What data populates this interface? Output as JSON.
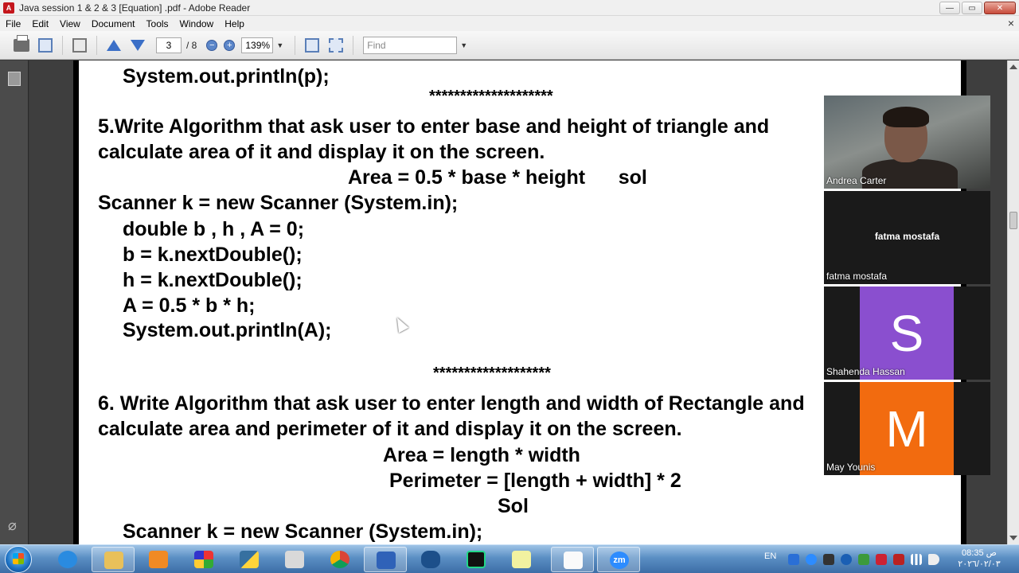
{
  "window": {
    "title": "Java session 1 & 2 & 3 [Equation] .pdf - Adobe Reader",
    "app_icon": "pdf-icon",
    "controls": {
      "minimize": "—",
      "restore": "▭",
      "close": "✕"
    }
  },
  "menu": {
    "items": [
      "File",
      "Edit",
      "View",
      "Document",
      "Tools",
      "Window",
      "Help"
    ],
    "close_glyph": "×"
  },
  "toolbar": {
    "page_current": "3",
    "page_total": "/ 8",
    "zoom_out": "−",
    "zoom_in": "+",
    "zoom_value": "139%",
    "find_placeholder": "Find",
    "icons": [
      "printer-icon",
      "pages-dropdown-icon",
      "collaborate-icon",
      "previous-page-icon",
      "next-page-icon",
      "zoom-out-icon",
      "zoom-in-icon",
      "fit-page-icon",
      "fit-width-icon"
    ]
  },
  "leftnav": {
    "icons": [
      "pages-panel-icon",
      "attachments-icon"
    ],
    "clip_glyph": "⌀"
  },
  "document": {
    "lines": [
      "System.out.println(p);",
      "********************",
      "5.Write Algorithm that ask user to enter base and height of triangle and",
      "calculate area of it and display it on the screen.",
      "Area = 0.5 * base * height      sol",
      "Scanner k = new Scanner (System.in);",
      "double b , h , A = 0;",
      "b = k.nextDouble();",
      "h = k.nextDouble();",
      "A = 0.5 * b * h;",
      "System.out.println(A);",
      "*******************",
      "6. Write Algorithm that ask user to enter length and width of Rectangle and",
      "calculate area and perimeter of it and display it on the screen.",
      "Area = length * width",
      "Perimeter = [length + width] * 2",
      "Sol",
      "Scanner k = new Scanner (System.in);"
    ]
  },
  "participants": [
    {
      "name": "Andrea Carter",
      "type": "camera"
    },
    {
      "name": "fatma mostafa",
      "type": "name",
      "center_label": "fatma mostafa"
    },
    {
      "name": "Shahenda Hassan",
      "type": "avatar",
      "initial": "S",
      "color": "#8a4fcf"
    },
    {
      "name": "May Younis",
      "type": "avatar",
      "initial": "M",
      "color": "#f26b0f"
    }
  ],
  "taskbar": {
    "apps": [
      "internet-explorer-icon",
      "file-explorer-icon",
      "media-player-icon",
      "office-icon",
      "python-icon",
      "snipping-tool-icon",
      "chrome-icon",
      "virtualbox-icon",
      "arduino-icon",
      "pycharm-icon",
      "paint-icon",
      "notepad-icon",
      "zoom-icon"
    ],
    "zoom_label": "zm",
    "language": "EN",
    "clock_time": "08:35 ص",
    "clock_date": "٢٠٢٦/٠٢/٠٣"
  }
}
